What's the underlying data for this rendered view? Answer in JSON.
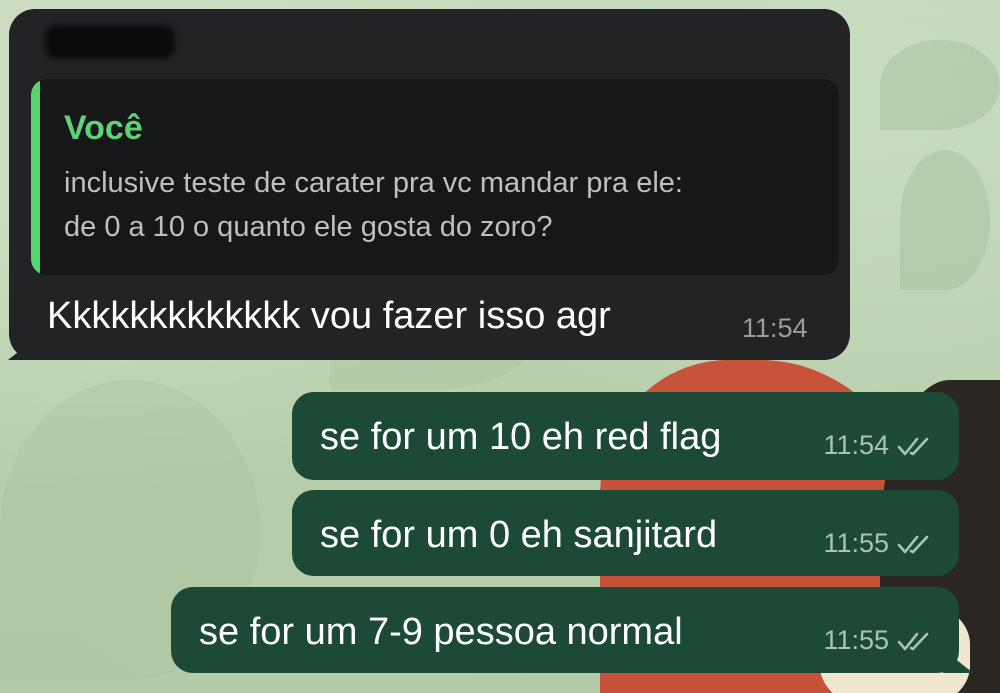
{
  "incoming": {
    "sender_name": "",
    "reply": {
      "author": "Você",
      "lines": [
        "inclusive teste de carater pra vc mandar pra ele:",
        "de 0 a 10 o quanto ele gosta do zoro?"
      ]
    },
    "text": "Kkkkkkkkkkkkk vou fazer isso agr",
    "time": "11:54"
  },
  "outgoing": [
    {
      "text": "se for um 10 eh red flag",
      "time": "11:54",
      "status_icon": "double-check-icon"
    },
    {
      "text": "se for um 0 eh sanjitard",
      "time": "11:55",
      "status_icon": "double-check-icon"
    },
    {
      "text": "se for um 7-9 pessoa normal",
      "time": "11:55",
      "status_icon": "double-check-icon"
    }
  ],
  "colors": {
    "incoming_bubble": "#222325",
    "outgoing_bubble": "#1c4a37",
    "reply_accent": "#56d66e"
  }
}
